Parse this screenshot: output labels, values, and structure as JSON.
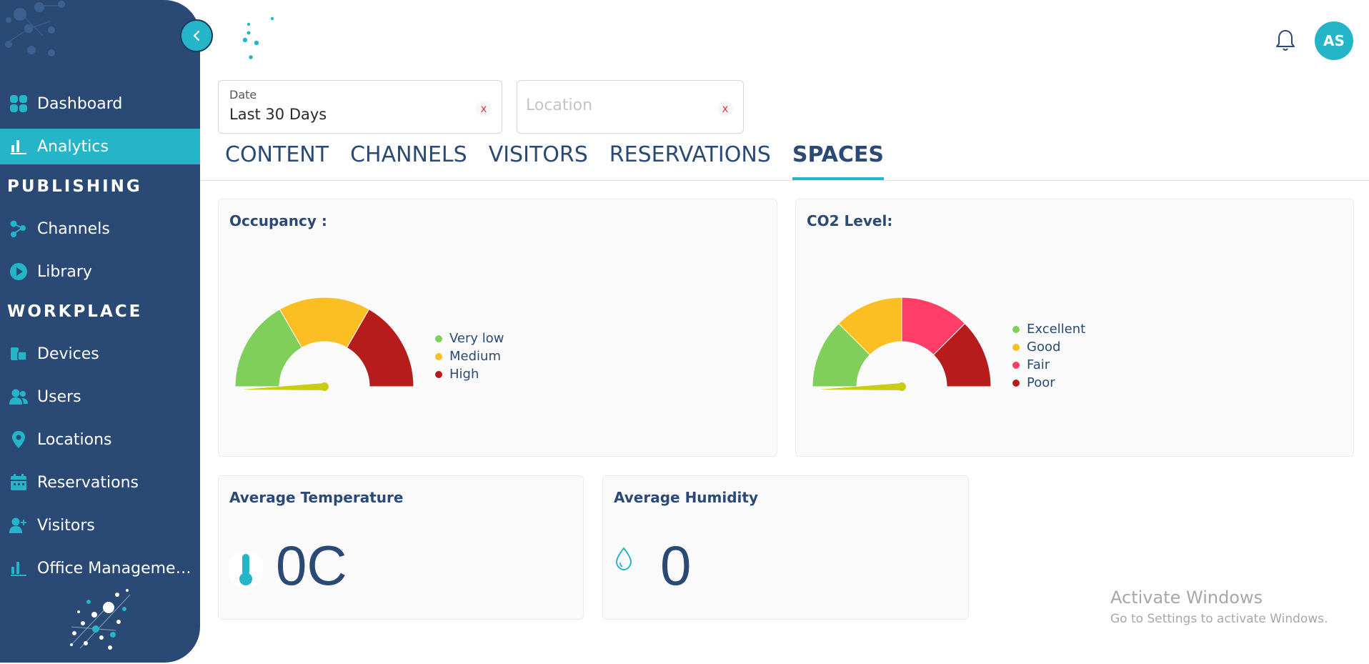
{
  "sidebar": {
    "items": [
      {
        "label": "Dashboard",
        "icon": "grid-icon"
      },
      {
        "label": "Analytics",
        "icon": "bar-chart-icon",
        "active": true
      },
      {
        "label": "Channels",
        "icon": "share-nodes-icon"
      },
      {
        "label": "Library",
        "icon": "play-circle-icon"
      },
      {
        "label": "Devices",
        "icon": "devices-icon"
      },
      {
        "label": "Users",
        "icon": "users-icon"
      },
      {
        "label": "Locations",
        "icon": "map-pin-icon"
      },
      {
        "label": "Reservations",
        "icon": "calendar-icon"
      },
      {
        "label": "Visitors",
        "icon": "user-plus-icon"
      },
      {
        "label": "Office Manageme…",
        "icon": "bar-chart-icon"
      }
    ],
    "sections": {
      "publishing": "PUBLISHING",
      "workplace": "WORKPLACE"
    }
  },
  "header": {
    "avatar_initials": "AS"
  },
  "filters": {
    "date": {
      "label": "Date",
      "value": "Last 30 Days",
      "clear": "x"
    },
    "location": {
      "placeholder": "Location",
      "clear": "x"
    }
  },
  "tabs": [
    {
      "label": "CONTENT"
    },
    {
      "label": "CHANNELS"
    },
    {
      "label": "VISITORS"
    },
    {
      "label": "RESERVATIONS"
    },
    {
      "label": "SPACES",
      "active": true
    }
  ],
  "occupancy": {
    "title": "Occupancy :",
    "legend": [
      "Very low",
      "Medium",
      "High"
    ],
    "colors": [
      "#7fcf5a",
      "#fbbf24",
      "#b71c1c"
    ],
    "needle_value": 0
  },
  "co2": {
    "title": "CO2 Level:",
    "legend": [
      "Excellent",
      "Good",
      "Fair",
      "Poor"
    ],
    "colors": [
      "#7fcf5a",
      "#fbbf24",
      "#ff3d67",
      "#b71c1c"
    ],
    "needle_value": 0
  },
  "temperature": {
    "title": "Average Temperature",
    "value": "0C",
    "icon": "thermometer-icon"
  },
  "humidity": {
    "title": "Average Humidity",
    "value": "0",
    "icon": "droplet-icon"
  },
  "watermark": {
    "line1": "Activate Windows",
    "line2": "Go to Settings to activate Windows."
  },
  "colors": {
    "sidebar": "#2a4a75",
    "accent": "#25b5c9",
    "needle": "#c8cc12"
  }
}
